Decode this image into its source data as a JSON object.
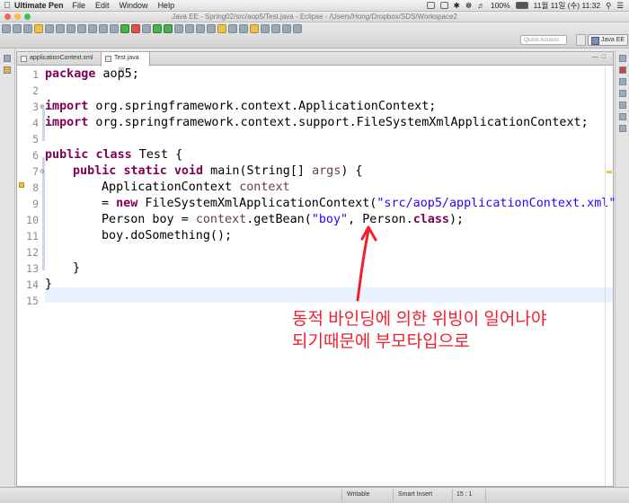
{
  "menubar": {
    "app_name": "Ultimate Pen",
    "items": [
      "File",
      "Edit",
      "Window",
      "Help"
    ],
    "battery": "100%",
    "datetime": "11월 11일 (수)  11:32"
  },
  "window": {
    "title": "Java EE - Spring02/src/aop5/Test.java - Eclipse - /Users/Hong/Dropbox/SDS/Workspace2"
  },
  "toolbar": {
    "quick_access_placeholder": "Quick Access",
    "perspective_label": "Java EE"
  },
  "editor": {
    "tabs": [
      {
        "label": "applicationContext.xml",
        "active": false
      },
      {
        "label": "Test.java",
        "active": true,
        "close": "☒"
      }
    ],
    "line_numbers": [
      "1",
      "2",
      "3",
      "4",
      "5",
      "6",
      "7",
      "8",
      "9",
      "10",
      "11",
      "12",
      "13",
      "14",
      "15"
    ],
    "code": {
      "l1_kw": "package",
      "l1_rest": " aop5;",
      "l3_kw": "import",
      "l3_rest": " org.springframework.context.ApplicationContext;",
      "l4_kw": "import",
      "l4_rest": " org.springframework.context.support.FileSystemXmlApplicationContext;",
      "l6_kw1": "public",
      "l6_kw2": "class",
      "l6_rest": " Test {",
      "l7_kw1": "public",
      "l7_kw2": "static",
      "l7_kw3": "void",
      "l7_mid": " main(String[] ",
      "l7_var": "args",
      "l7_end": ") {",
      "l8_type": "ApplicationContext ",
      "l8_var": "context",
      "l9_eq": "= ",
      "l9_kw": "new",
      "l9_mid": " FileSystemXmlApplicationContext(",
      "l9_str": "\"src/aop5/applicationContext.xml\"",
      "l10_a": "Person boy = ",
      "l10_var": "context",
      "l10_b": ".getBean(",
      "l10_str": "\"boy\"",
      "l10_c": ", Person.",
      "l10_kw": "class",
      "l10_d": ");",
      "l11": "boy.doSomething();",
      "l13": "}",
      "l14": "}"
    }
  },
  "annotation": {
    "line1": "동적 바인딩에 의한 위빙이 일어나야",
    "line2": "되기때문에 부모타입으로",
    "color": "#f12030"
  },
  "statusbar": {
    "mode": "Writable",
    "insert": "Smart Insert",
    "position": "15 : 1"
  }
}
